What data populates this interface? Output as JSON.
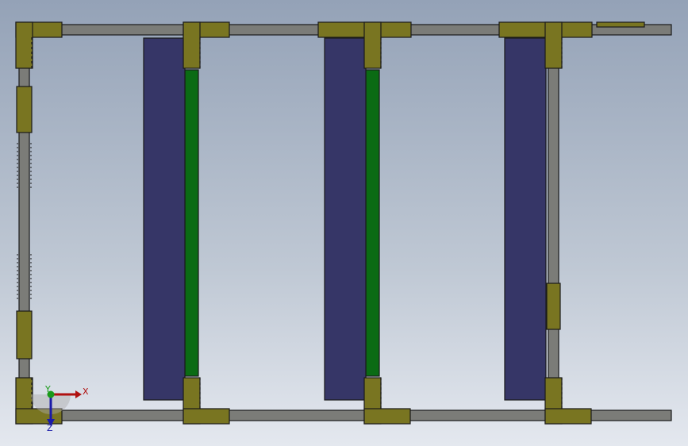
{
  "viewport": {
    "background_top": "#94a2b7",
    "background_bottom": "#e4e8ef"
  },
  "colors": {
    "tube": "#7b7c78",
    "tube_stroke": "#1a1a1a",
    "connector": "#797521",
    "panel": "#363667",
    "green_bar": "#0b6b14"
  },
  "triad": {
    "x_label": "X",
    "y_label": "Y",
    "z_label": "Z",
    "x_color": "#b01010",
    "y_color": "#1a9a1a",
    "z_color": "#1a1aa8"
  }
}
